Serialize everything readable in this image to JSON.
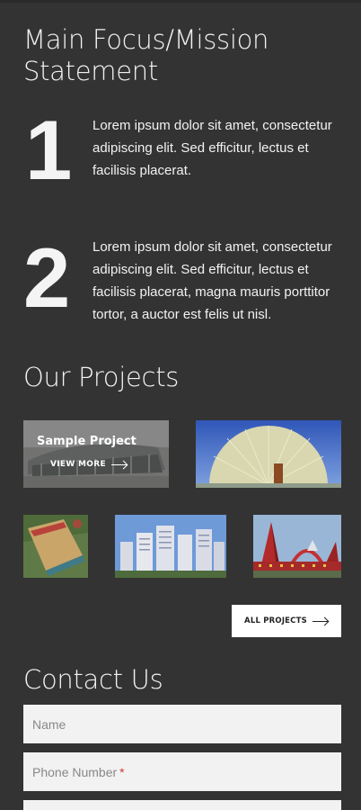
{
  "mission": {
    "title_line1": "Main Focus/Mission",
    "title_line2": "Statement",
    "items": [
      {
        "number": "1",
        "text": "Lorem ipsum dolor sit amet, consectetur adipiscing elit. Sed efficitur, lectus et facilisis placerat."
      },
      {
        "number": "2",
        "text": "Lorem ipsum dolor sit amet, consectetur adipiscing elit. Sed efficitur, lectus et facilisis placerat, magna mauris porttitor tortor, a auctor est felis ut nisl."
      }
    ]
  },
  "projects": {
    "title": "Our Projects",
    "featured": {
      "title": "Sample Project",
      "link_label": "VIEW MORE"
    },
    "all_projects_label": "ALL PROJECTS"
  },
  "contact": {
    "title": "Contact Us",
    "name_placeholder": "Name",
    "phone_placeholder": "Phone Number",
    "required_marker": "*"
  },
  "colors": {
    "background": "#333333",
    "field_background": "#f2f2f2",
    "required": "#d9383c"
  }
}
